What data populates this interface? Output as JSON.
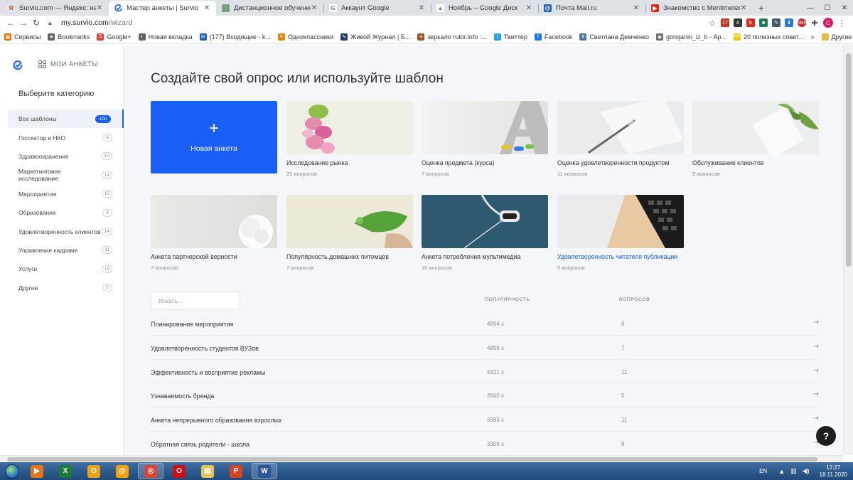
{
  "browser": {
    "tabs": [
      {
        "title": "Survio.com — Яндекс: нашлось",
        "fav_color": "#e8e8e8",
        "fav_text": "Я",
        "fav_fg": "#e52620",
        "active": false
      },
      {
        "title": "Мастер анкеты | Survio",
        "fav_color": "#ffffff",
        "fav_text": "",
        "fav_fg": "#1a5ff5",
        "active": true
      },
      {
        "title": "Дистанционное обучение в Ак",
        "fav_color": "#7a9e7e",
        "fav_text": "",
        "fav_fg": "#fff",
        "active": false
      },
      {
        "title": "Аккаунт Google",
        "fav_color": "#ffffff",
        "fav_text": "G",
        "fav_fg": "#4285f4",
        "active": false
      },
      {
        "title": "Ноябрь – Google Диск",
        "fav_color": "#ffffff",
        "fav_text": "▲",
        "fav_fg": "#34a853",
        "active": false
      },
      {
        "title": "Почта Mail.ru",
        "fav_color": "#1b5fb8",
        "fav_text": "@",
        "fav_fg": "#fff",
        "active": false
      },
      {
        "title": "Знакомство с Mentimeter - You",
        "fav_color": "#e62117",
        "fav_text": "▶",
        "fav_fg": "#fff",
        "active": false
      }
    ],
    "url_host": "my.survio.com",
    "url_path": "/wizard",
    "bookmarks": [
      {
        "label": "Сервисы",
        "color": "#e8710a",
        "glyph": "▦"
      },
      {
        "label": "Bookmarks",
        "color": "#5f6368",
        "glyph": "★"
      },
      {
        "label": "Google+",
        "color": "#db4437",
        "glyph": "G"
      },
      {
        "label": "Новая вкладка",
        "color": "#5f6368",
        "glyph": "◐"
      },
      {
        "label": "(177) Входящие - k...",
        "color": "#1b5fb8",
        "glyph": "✉"
      },
      {
        "label": "Одноклассники",
        "color": "#ee8208",
        "glyph": "o"
      },
      {
        "label": "Живой Журнал | Б...",
        "color": "#1a3d6e",
        "glyph": "✎"
      },
      {
        "label": "зеркало rutor.info :...",
        "color": "#a0522d",
        "glyph": "☀"
      },
      {
        "label": "Твиттер",
        "color": "#1da1f2",
        "glyph": "t"
      },
      {
        "label": "Facebook",
        "color": "#1877f2",
        "glyph": "f"
      },
      {
        "label": "Светлана Демченко",
        "color": "#4a76a8",
        "glyph": "в"
      },
      {
        "label": "gorojanin_iz_b - Ар...",
        "color": "#6b6b6b",
        "glyph": "◉"
      },
      {
        "label": "20 полезных совет...",
        "color": "#f2c500",
        "glyph": "AD"
      }
    ],
    "bookmarks_other": "Другие закладки"
  },
  "sidebar": {
    "my_surveys": "МОИ АНКЕТЫ",
    "choose_category": "Выберите категорию",
    "categories": [
      {
        "label": "Все шаблоны",
        "count": "100",
        "active": true
      },
      {
        "label": "Госсектор и НКО",
        "count": "8"
      },
      {
        "label": "Здравоохранение",
        "count": "10"
      },
      {
        "label": "Маркетинговое исследование",
        "count": "14"
      },
      {
        "label": "Мероприятия",
        "count": "10"
      },
      {
        "label": "Образование",
        "count": "9"
      },
      {
        "label": "Удовлетворенность клиентов",
        "count": "14"
      },
      {
        "label": "Управление кадрами",
        "count": "11"
      },
      {
        "label": "Услуги",
        "count": "19"
      },
      {
        "label": "Другие",
        "count": "5"
      }
    ]
  },
  "main": {
    "heading": "Создайте свой опрос или используйте шаблон",
    "new_survey": "Новая анкета",
    "templates": [
      {
        "name": "Исследование рынка",
        "count": "20 вопросов",
        "thumb": "flowers"
      },
      {
        "name": "Оценка предмета (курса)",
        "count": "7 вопросов",
        "thumb": "letter-a"
      },
      {
        "name": "Оценка удовлетворенности продуктом",
        "count": "11 вопросов",
        "thumb": "pen"
      },
      {
        "name": "Обслуживание клиентов",
        "count": "9 вопросов",
        "thumb": "leaves"
      },
      {
        "name": "Анкета партнерской верности",
        "count": "7 вопросов",
        "thumb": "rose"
      },
      {
        "name": "Популярность домашних питомцев",
        "count": "7 вопросов",
        "thumb": "chameleon"
      },
      {
        "name": "Анкета потребления мультимедиа",
        "count": "10 вопросов",
        "thumb": "headphones"
      },
      {
        "name": "Удовлетворенность читателя публикации",
        "count": "5 вопросов",
        "thumb": "laptop",
        "link": true
      }
    ],
    "search_placeholder": "Искать...",
    "col_popularity": "ПОПУЛЯРНОСТЬ",
    "col_questions": "ВОПРОСОВ",
    "rows": [
      {
        "title": "Планирование мероприятия",
        "popularity": "4894 x",
        "questions": "8"
      },
      {
        "title": "Удовлетворенность студентов ВУЗов",
        "popularity": "4808 x",
        "questions": "7"
      },
      {
        "title": "Эффективность и восприятие рекламы",
        "popularity": "4321 x",
        "questions": "11"
      },
      {
        "title": "Узнаваемость бренда",
        "popularity": "3560 x",
        "questions": "5"
      },
      {
        "title": "Анкета непрерывного образования взрослых",
        "popularity": "3383 x",
        "questions": "11"
      },
      {
        "title": "Обратная связь родители - школа",
        "popularity": "3308 x",
        "questions": "8"
      }
    ],
    "help": "?"
  },
  "taskbar": {
    "apps": [
      {
        "name": "media-player-icon",
        "color": "#e6731a",
        "glyph": "▶",
        "on": false
      },
      {
        "name": "excel-icon",
        "color": "#1d7a3a",
        "glyph": "X",
        "on": false
      },
      {
        "name": "outlook-icon",
        "color": "#e8a317",
        "glyph": "O",
        "on": false
      },
      {
        "name": "mail-agent-icon",
        "color": "#f5a20a",
        "glyph": "@",
        "on": false
      },
      {
        "name": "chrome-icon",
        "color": "#db4437",
        "glyph": "◎",
        "on": true
      },
      {
        "name": "opera-icon",
        "color": "#cc0f16",
        "glyph": "O",
        "on": false
      },
      {
        "name": "explorer-folder-icon",
        "color": "#e8c15a",
        "glyph": "▤",
        "on": false
      },
      {
        "name": "powerpoint-icon",
        "color": "#d24726",
        "glyph": "P",
        "on": false
      },
      {
        "name": "word-icon",
        "color": "#2b579a",
        "glyph": "W",
        "on": true
      }
    ],
    "lang": "EN",
    "time": "12:27",
    "date": "18.11.2020"
  }
}
